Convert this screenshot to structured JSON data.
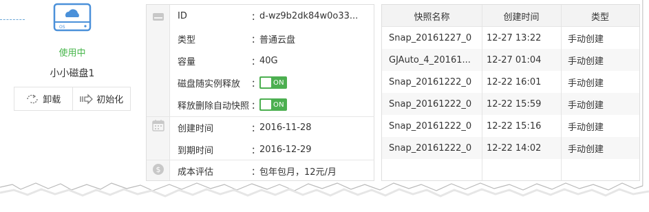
{
  "disk": {
    "status": "使用中",
    "name": "小小磁盘1",
    "icon_label": "OS",
    "actions": [
      {
        "label": "卸载",
        "icon": "unmount-icon"
      },
      {
        "label": "初始化",
        "icon": "initialize-icon"
      }
    ]
  },
  "info": {
    "rows": [
      {
        "key": "ID",
        "value": "d-wz9b2dk84w0o33..."
      },
      {
        "key": "类型",
        "value": "普通云盘"
      },
      {
        "key": "容量",
        "value": "40G"
      },
      {
        "key": "磁盘随实例释放",
        "toggle": "ON"
      },
      {
        "key": "释放删除自动快照",
        "toggle": "ON"
      },
      {
        "key": "创建时间",
        "value": "2016-11-28"
      },
      {
        "key": "到期时间",
        "value": "2016-12-29"
      },
      {
        "key": "成本评估",
        "value": "包年包月，12元/月"
      }
    ],
    "colon": "：",
    "cost_icon": "$",
    "toggle_color": "#4caf50"
  },
  "snapshots": {
    "headers": [
      "快照名称",
      "创建时间",
      "类型"
    ],
    "rows": [
      {
        "name": "Snap_20161227_0",
        "time": "12-27 13:22",
        "type": "手动创建"
      },
      {
        "name": "GJAuto_4_20161...",
        "time": "12-27 01:04",
        "type": "手动创建"
      },
      {
        "name": "Snap_20161222_0",
        "time": "12-22 16:01",
        "type": "手动创建"
      },
      {
        "name": "Snap_20161222_0",
        "time": "12-22 15:59",
        "type": "手动创建"
      },
      {
        "name": "Snap_20161222_0",
        "time": "12-22 15:16",
        "type": "手动创建"
      },
      {
        "name": "Snap_20161222_0",
        "time": "12-22 14:02",
        "type": "手动创建"
      }
    ]
  },
  "colors": {
    "status_green": "#45b549",
    "disk_blue": "#4a90d9"
  }
}
